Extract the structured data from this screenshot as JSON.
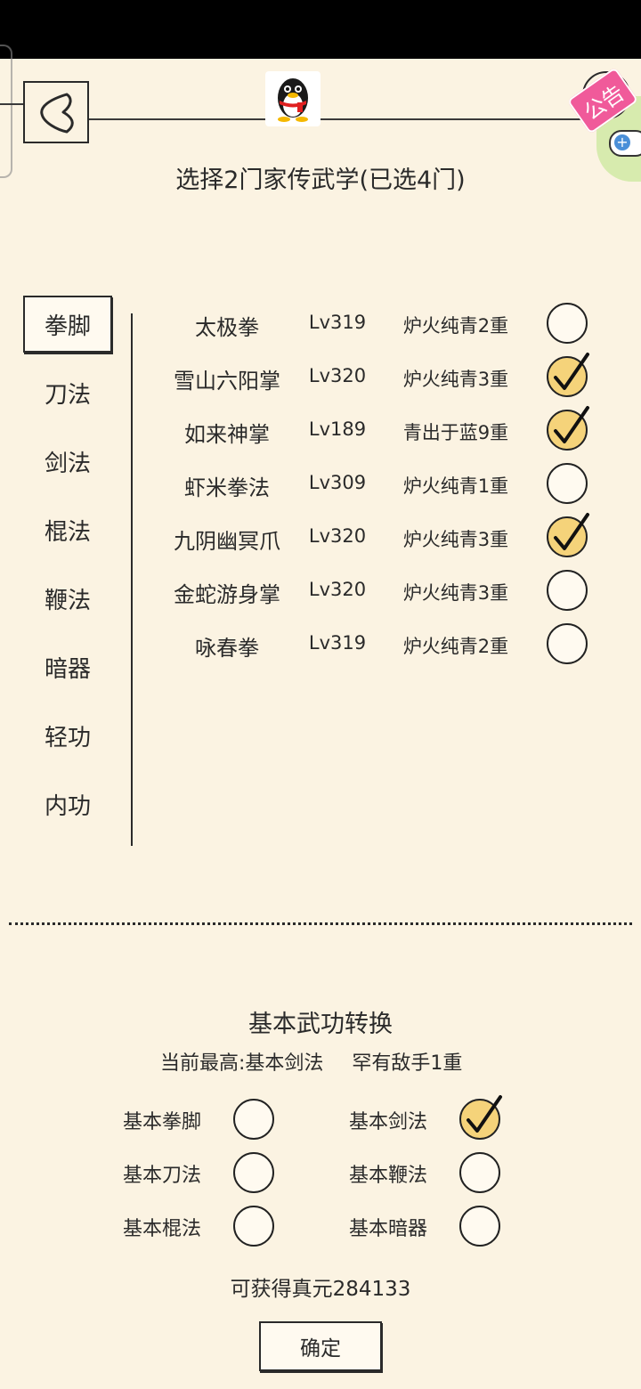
{
  "header": {
    "title": "选择2门家传武学(已选4门)",
    "notice_label": "公告"
  },
  "tabs": [
    {
      "label": "拳脚",
      "active": true
    },
    {
      "label": "刀法",
      "active": false
    },
    {
      "label": "剑法",
      "active": false
    },
    {
      "label": "棍法",
      "active": false
    },
    {
      "label": "鞭法",
      "active": false
    },
    {
      "label": "暗器",
      "active": false
    },
    {
      "label": "轻功",
      "active": false
    },
    {
      "label": "内功",
      "active": false
    }
  ],
  "skills": [
    {
      "name": "太极拳",
      "level": "Lv319",
      "rank": "炉火纯青2重",
      "checked": false
    },
    {
      "name": "雪山六阳掌",
      "level": "Lv320",
      "rank": "炉火纯青3重",
      "checked": true
    },
    {
      "name": "如来神掌",
      "level": "Lv189",
      "rank": "青出于蓝9重",
      "checked": true
    },
    {
      "name": "虾米拳法",
      "level": "Lv309",
      "rank": "炉火纯青1重",
      "checked": false
    },
    {
      "name": "九阴幽冥爪",
      "level": "Lv320",
      "rank": "炉火纯青3重",
      "checked": true
    },
    {
      "name": "金蛇游身掌",
      "level": "Lv320",
      "rank": "炉火纯青3重",
      "checked": false
    },
    {
      "name": "咏春拳",
      "level": "Lv319",
      "rank": "炉火纯青2重",
      "checked": false
    }
  ],
  "conversion": {
    "title": "基本武功转换",
    "current_label": "当前最高:基本剑法",
    "current_rank": "罕有敌手1重",
    "options": [
      {
        "label": "基本拳脚",
        "checked": false
      },
      {
        "label": "基本剑法",
        "checked": true
      },
      {
        "label": "基本刀法",
        "checked": false
      },
      {
        "label": "基本鞭法",
        "checked": false
      },
      {
        "label": "基本棍法",
        "checked": false
      },
      {
        "label": "基本暗器",
        "checked": false
      }
    ],
    "gain_text": "可获得真元284133",
    "confirm_label": "确定"
  },
  "colors": {
    "background": "#fbf3e2",
    "check_fill": "#f5d37a",
    "notice_pink": "#f05a9a"
  },
  "icons": [
    "back-arrow-icon",
    "qq-penguin-icon",
    "notice-icon",
    "add-icon",
    "checkmark-icon"
  ]
}
